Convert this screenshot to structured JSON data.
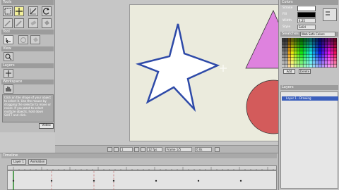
{
  "tools_panel": {
    "title": "Tools",
    "options_title": "Tool",
    "view_title": "View",
    "layers_title": "Layers",
    "workspace_title": "Workspace",
    "help_text": "Click on the shape of your object to select it. Use the mouse by dragging the selector to move or resize. If you want to select multiple objects, hold down SHIFT and click.",
    "video_label": "Video"
  },
  "status_bar": {
    "frame_field": "1",
    "rate_field": "12 fps",
    "zoom_field": "Frame 1/5",
    "time_field": "0.0s"
  },
  "right_panel": {
    "color_title": "Colors",
    "stroke_label": "Stroke",
    "fill_label": "Fill",
    "width_label": "Width",
    "width_value": "4.25",
    "style_label": "Style",
    "style_value": "Solid",
    "swatches_title": "Swatches",
    "swatch_set": "Web Safe Colors",
    "add_button": "Add",
    "delete_button": "Delete",
    "layers_title": "Layers",
    "layer_name": "Layer 1 - Drawing",
    "stroke_color": "#ffffff",
    "fill_color": "#000000"
  },
  "timeline": {
    "tab1": "Layer 1",
    "tab2": "Animation",
    "title": "Timeline"
  },
  "stage": {
    "star_fill": "#ffffff",
    "star_stroke": "#2e4aa8",
    "triangle_fill": "#de82de",
    "circle_fill": "#d35b5b"
  }
}
